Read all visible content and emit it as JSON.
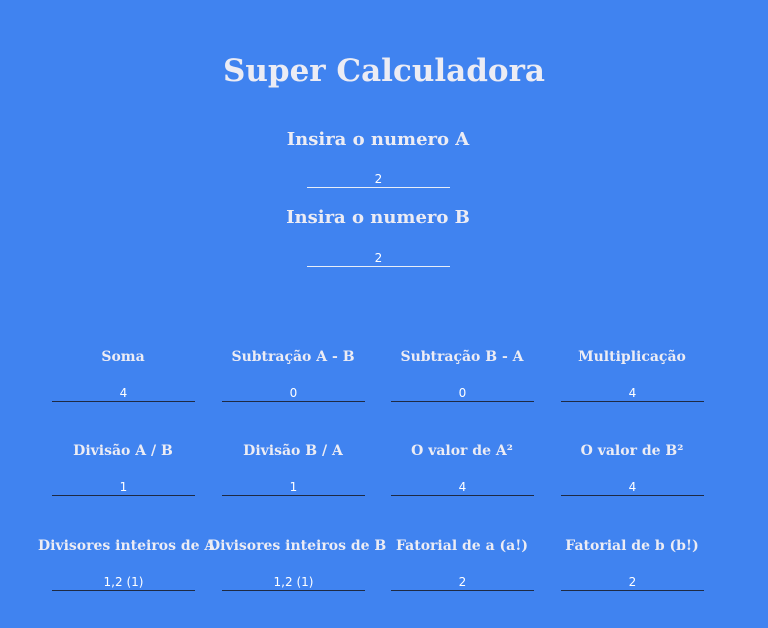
{
  "page": {
    "title": "Super Calculadora"
  },
  "inputs": {
    "a_label": "Insira o numero A",
    "a_value": "2",
    "b_label": "Insira o numero B",
    "b_value": "2"
  },
  "results": [
    {
      "label": "Soma",
      "value": "4"
    },
    {
      "label": "Subtração A - B",
      "value": "0"
    },
    {
      "label": "Subtração B - A",
      "value": "0"
    },
    {
      "label": "Multiplicação",
      "value": "4"
    },
    {
      "label": "Divisão A / B",
      "value": "1"
    },
    {
      "label": "Divisão B / A",
      "value": "1"
    },
    {
      "label": "O valor de A²",
      "value": "4"
    },
    {
      "label": "O valor de B²",
      "value": "4"
    },
    {
      "label": "Divisores inteiros de A",
      "value": "1,2 (1)"
    },
    {
      "label": "Divisores inteiros de B",
      "value": "1,2 (1)"
    },
    {
      "label": "Fatorial de a (a!)",
      "value": "2"
    },
    {
      "label": "Fatorial de b (b!)",
      "value": "2"
    }
  ]
}
